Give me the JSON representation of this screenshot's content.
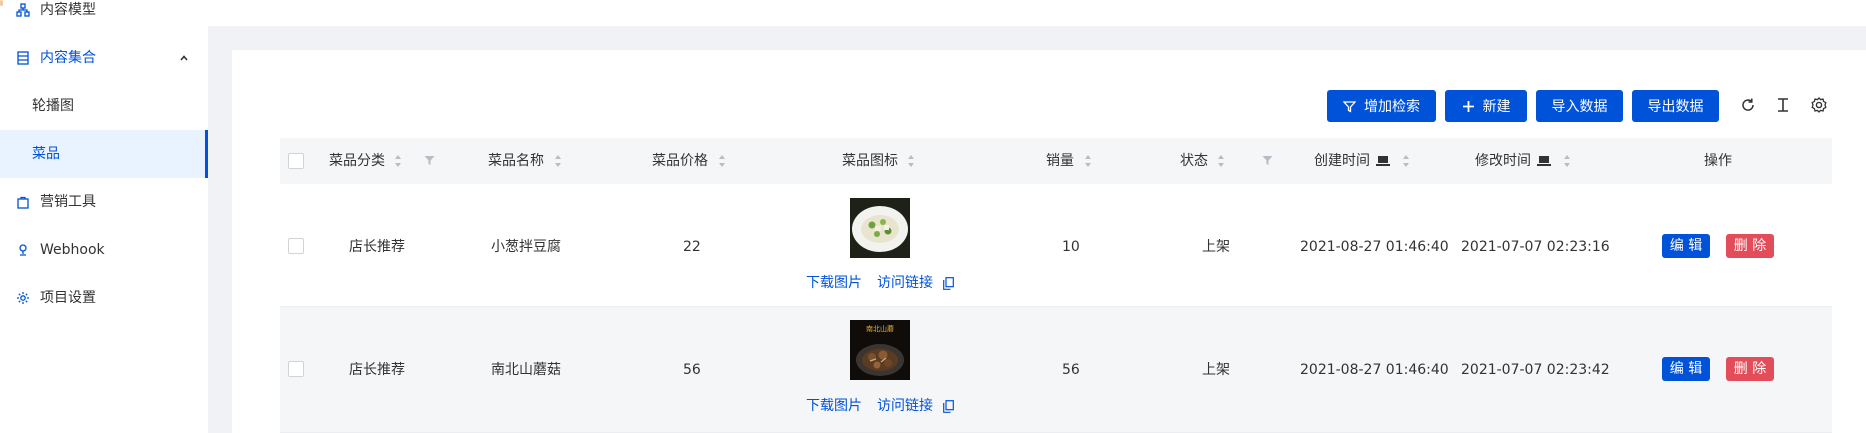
{
  "sidebar": {
    "items": [
      {
        "label": "内容模型",
        "icon": "model-icon"
      },
      {
        "label": "内容集合",
        "icon": "collection-icon",
        "expanded": true
      },
      {
        "label": "轮播图"
      },
      {
        "label": "菜品",
        "selected": true
      },
      {
        "label": "营销工具",
        "icon": "bag-icon"
      },
      {
        "label": "Webhook",
        "icon": "webhook-icon"
      },
      {
        "label": "项目设置",
        "icon": "gear-icon"
      }
    ]
  },
  "toolbar": {
    "add_filter_label": "增加检索",
    "new_label": "新建",
    "import_label": "导入数据",
    "export_label": "导出数据",
    "icons": [
      "refresh-icon",
      "text-height-icon",
      "settings-icon"
    ]
  },
  "table": {
    "columns": [
      "菜品分类",
      "菜品名称",
      "菜品价格",
      "菜品图标",
      "销量",
      "状态",
      "创建时间",
      "修改时间",
      "操作"
    ],
    "download_label": "下载图片",
    "visit_label": "访问链接",
    "edit_label": "编 辑",
    "delete_label": "删 除",
    "rows": [
      {
        "category": "店长推荐",
        "name": "小葱拌豆腐",
        "price": "22",
        "sales": "10",
        "status": "上架",
        "created": "2021-08-27 01:46:40",
        "modified": "2021-07-07 02:23:16",
        "image_caption": ""
      },
      {
        "category": "店长推荐",
        "name": "南北山蘑菇",
        "price": "56",
        "sales": "56",
        "status": "上架",
        "created": "2021-08-27 01:46:40",
        "modified": "2021-07-07 02:23:42",
        "image_caption": "南北山蘑"
      }
    ]
  },
  "colors": {
    "primary": "#0052d9",
    "danger": "#e34d59",
    "selected_bg": "#e8f3ff"
  }
}
